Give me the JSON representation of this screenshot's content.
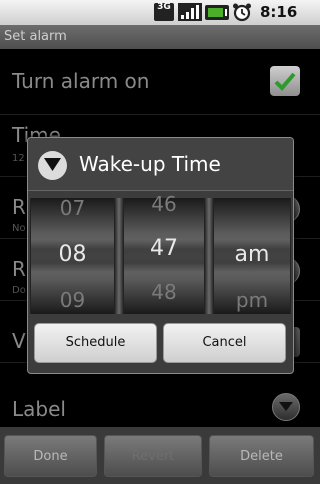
{
  "status_bar": {
    "network": "3G",
    "time": "8:16 PM",
    "icons": [
      "3g-icon",
      "signal-icon",
      "battery-icon",
      "alarm-clock-icon"
    ]
  },
  "title_bar": {
    "title": "Set alarm"
  },
  "list": {
    "turn_alarm_on": {
      "label": "Turn alarm on",
      "checked": true
    },
    "time": {
      "label": "Time",
      "summary": "12"
    },
    "ringtone": {
      "label": "R",
      "summary": "No"
    },
    "repeat": {
      "label": "R",
      "summary": "Do"
    },
    "vibrate": {
      "label": "V"
    },
    "label": {
      "label": "Label"
    }
  },
  "dialog": {
    "title": "Wake-up Time",
    "hour": {
      "prev": "07",
      "current": "08",
      "next": "09"
    },
    "minute": {
      "prev": "46",
      "current": "47",
      "next": "48"
    },
    "ampm": {
      "prev": "",
      "current": "am",
      "next": "pm"
    },
    "schedule_label": "Schedule",
    "cancel_label": "Cancel"
  },
  "bottom_bar": {
    "done_label": "Done",
    "revert_label": "Revert",
    "delete_label": "Delete"
  },
  "colors": {
    "check_green": "#2e9a2e",
    "dialog_bg": "#3c3c3c"
  }
}
